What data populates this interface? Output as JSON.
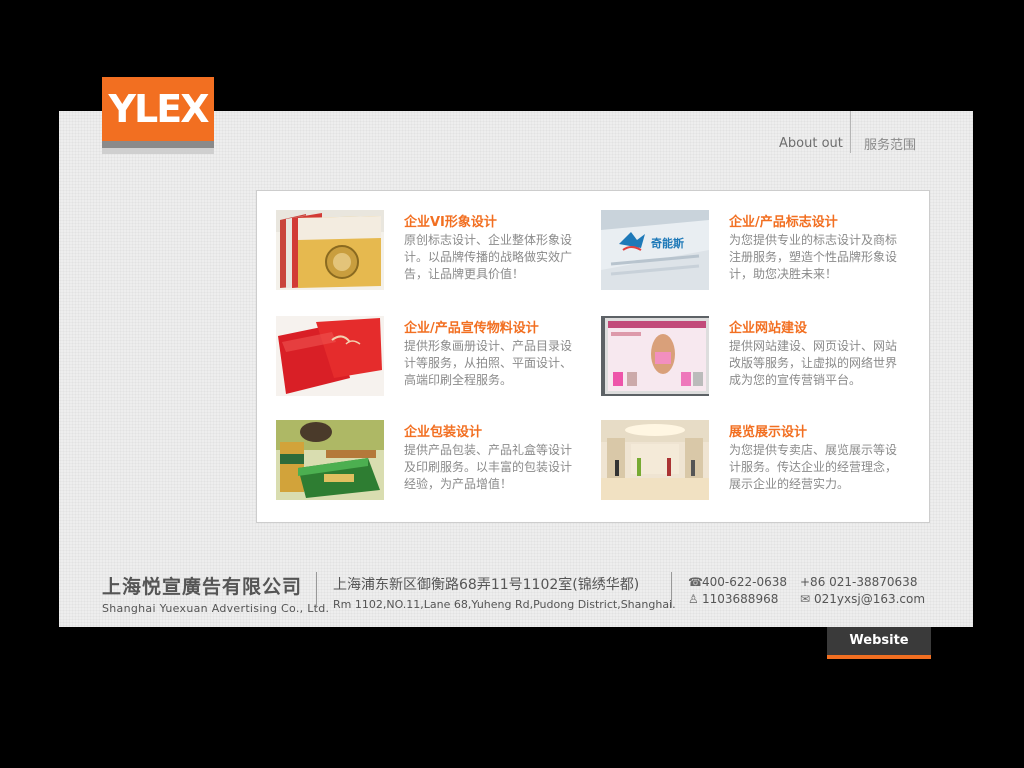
{
  "logo": {
    "text": "YLEX"
  },
  "nav": {
    "about": "About out",
    "service": "服务范围"
  },
  "services": [
    {
      "title": "企业VI形象设计",
      "desc": "原创标志设计、企业整体形象设计。以品牌传播的战略做实效广告，让品牌更具价值！",
      "image": "vi-books-photo"
    },
    {
      "title": "企业/产品标志设计",
      "desc": "为您提供专业的标志设计及商标注册服务，塑造个性品牌形象设计，助您决胜未来！",
      "image": "logo-print-photo",
      "image_text": "奇能斯"
    },
    {
      "title": "企业/产品宣传物料设计",
      "desc": "提供形象画册设计、产品目录设计等服务，从拍照、平面设计、高端印刷全程服务。",
      "image": "red-brochures-photo"
    },
    {
      "title": "企业网站建设",
      "desc": "提供网站建设、网页设计、网站改版等服务，让虚拟的网络世界成为您的宣传营销平台。",
      "image": "website-screen-photo"
    },
    {
      "title": "企业包装设计",
      "desc": "提供产品包装、产品礼盒等设计及印刷服务。以丰富的包装设计经验，为产品增值！",
      "image": "tea-packaging-photo"
    },
    {
      "title": "展览展示设计",
      "desc": "为您提供专卖店、展览展示等设计服务。传达企业的经营理念，展示企业的经营实力。",
      "image": "exhibition-hall-photo"
    }
  ],
  "footer": {
    "company_cn": "上海悦宣廣告有限公司",
    "company_en": "Shanghai Yuexuan Advertising Co., Ltd.",
    "address_cn": "上海浦东新区御衡路68弄11号1102室(锦绣华都)",
    "address_en": "Rm 1102,NO.11,Lane 68,Yuheng Rd,Pudong District,Shanghai.",
    "phone": "400-622-0638",
    "phone2": "+86 021-38870638",
    "qq": "1103688968",
    "email": "021yxsj@163.com"
  },
  "website_button": "Website",
  "colors": {
    "accent": "#f26f21",
    "panel": "#eeeeee",
    "text_gray": "#8a8a8a"
  },
  "icons": [
    "phone-icon",
    "qq-icon",
    "email-icon"
  ]
}
